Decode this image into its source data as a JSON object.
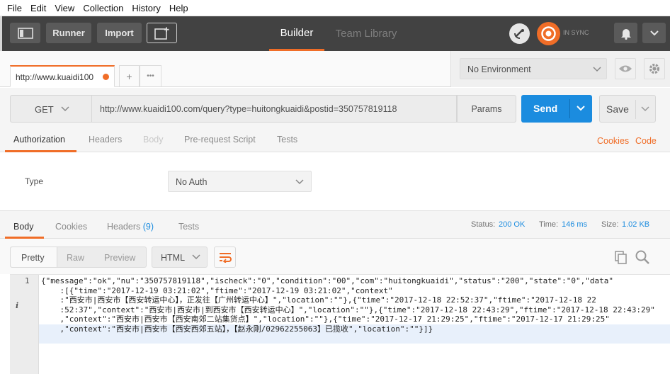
{
  "menubar": {
    "items": [
      "File",
      "Edit",
      "View",
      "Collection",
      "History",
      "Help"
    ]
  },
  "header": {
    "runner_label": "Runner",
    "import_label": "Import",
    "tabs": [
      {
        "label": "Builder",
        "active": true
      },
      {
        "label": "Team Library",
        "active": false
      }
    ],
    "sync_status": "IN SYNC",
    "accent": "#f06d27"
  },
  "request_tab": {
    "title": "http://www.kuaidi100",
    "add_label": "+",
    "more_label": "•••"
  },
  "environment": {
    "selected": "No Environment"
  },
  "request": {
    "method": "GET",
    "url": "http://www.kuaidi100.com/query?type=huitongkuaidi&postid=350757819118",
    "params_label": "Params",
    "send_label": "Send",
    "save_label": "Save"
  },
  "request_tabs": {
    "items": [
      "Authorization",
      "Headers",
      "Body",
      "Pre-request Script",
      "Tests"
    ],
    "cookies_label": "Cookies",
    "code_label": "Code"
  },
  "auth": {
    "type_label": "Type",
    "type_value": "No Auth"
  },
  "response": {
    "tabs": {
      "body": "Body",
      "cookies": "Cookies",
      "headers": "Headers",
      "headers_count": "(9)",
      "tests": "Tests"
    },
    "status_label": "Status:",
    "status_value": "200 OK",
    "time_label": "Time:",
    "time_value": "146 ms",
    "size_label": "Size:",
    "size_value": "1.02 KB",
    "view_modes": [
      "Pretty",
      "Raw",
      "Preview"
    ],
    "format": "HTML",
    "line_number": "1",
    "info_marker": "i",
    "body_lines": [
      "{\"message\":\"ok\",\"nu\":\"350757819118\",\"ischeck\":\"0\",\"condition\":\"00\",\"com\":\"huitongkuaidi\",\"status\":\"200\",\"state\":\"0\",\"data\"",
      "    :[{\"time\":\"2017-12-19 03:21:02\",\"ftime\":\"2017-12-19 03:21:02\",\"context\"",
      "    :\"西安市|西安市【西安转运中心】，正发往【广州转运中心】\",\"location\":\"\"},{\"time\":\"2017-12-18 22:52:37\",\"ftime\":\"2017-12-18 22",
      "    :52:37\",\"context\":\"西安市|西安市|到西安市【西安转运中心】\",\"location\":\"\"},{\"time\":\"2017-12-18 22:43:29\",\"ftime\":\"2017-12-18 22:43:29\"",
      "    ,\"context\":\"西安市|西安市【西安南郊二站集货点】\",\"location\":\"\"},{\"time\":\"2017-12-17 21:29:25\",\"ftime\":\"2017-12-17 21:29:25\"",
      "    ,\"context\":\"西安市|西安市【西安西郊五站】，【赵永刚/02962255063】已揽收\",\"location\":\"\"}]}"
    ]
  },
  "colors": {
    "send": "#1b8cdf",
    "link": "#1b8cdf",
    "orange": "#f06d27",
    "header_bg": "#424242"
  }
}
